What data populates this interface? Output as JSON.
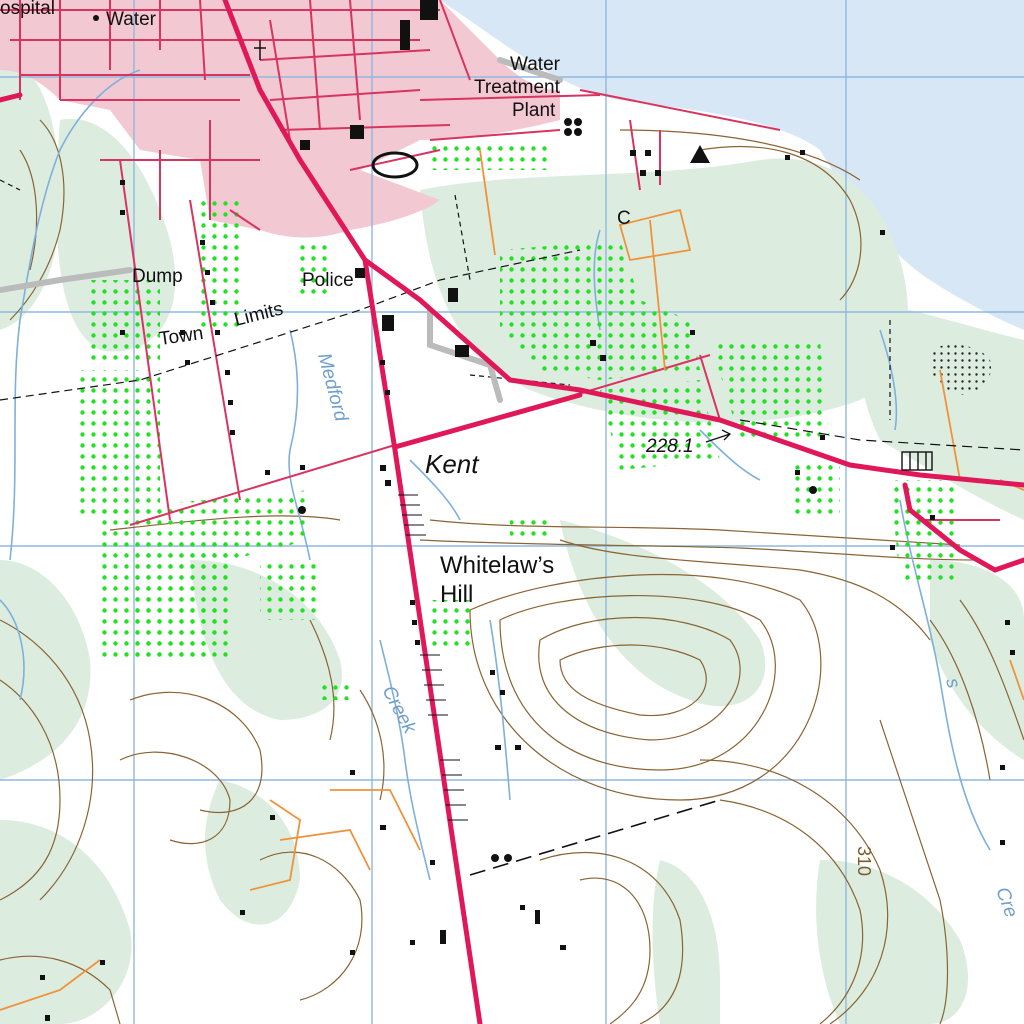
{
  "map": {
    "colors": {
      "water": "#d7e7f5",
      "woodland": "#dcede0",
      "orchard": "#22e022",
      "built_up": "#f2c8d2",
      "road_major": "#e0185a",
      "road_minor": "#d8345f",
      "contour": "#8a6433",
      "stream": "#7eb0dc",
      "grid": "#8fb8e0",
      "track": "#f0923a",
      "building": "#111111"
    },
    "labels": {
      "hospital": "ospital",
      "water": "Water",
      "water_treatment_line1": "Water",
      "water_treatment_line2": "Treatment",
      "water_treatment_line3": "Plant",
      "dump": "Dump",
      "police": "Police",
      "town": "Town",
      "limits": "Limits",
      "kent": "Kent",
      "whitelaw_line1": "Whitelaw’s",
      "whitelaw_line2": "Hill",
      "elevation": "228.1",
      "medford": "Medford",
      "creek": "Creek",
      "creek_right": "Cre",
      "contour_value": "310",
      "church_c": "C",
      "margin_right": "s"
    },
    "icons": [
      "campground-icon",
      "church-icon",
      "cemetery-icon",
      "police-station-icon"
    ]
  }
}
